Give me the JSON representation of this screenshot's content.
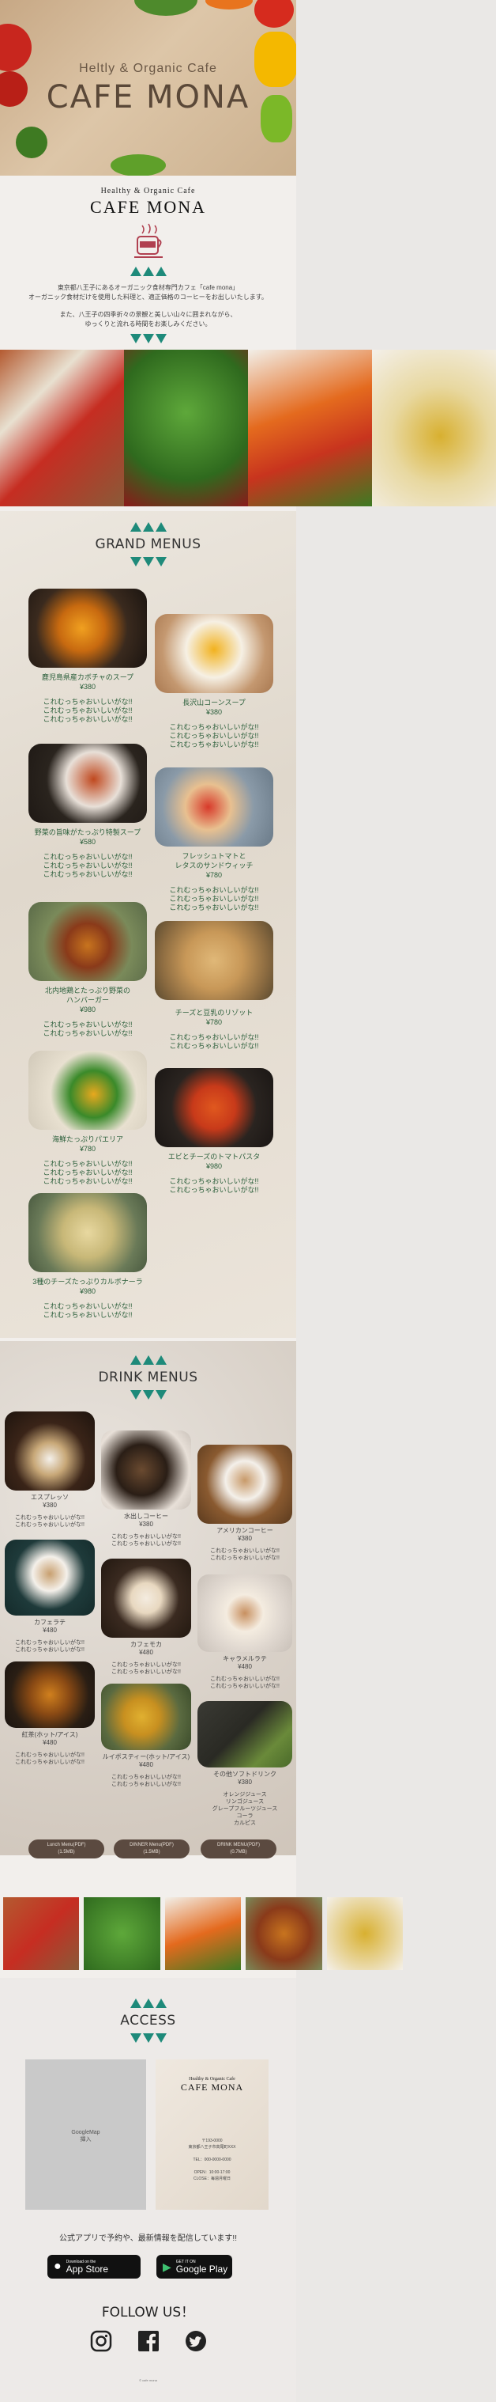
{
  "hero": {
    "subtitle": "Heltly & Organic Cafe",
    "title": "CAFE MONA"
  },
  "logo": {
    "subtitle": "Healthy & Organic Cafe",
    "title": "CAFE MONA"
  },
  "intro": {
    "line1": "東京都八王子にあるオーガニック食材専門カフェ「cafe mona」",
    "line2": "オーガニック食材だけを使用した料理と、適正価格のコーヒーをお出しいたします。",
    "line3": "また、八王子の四季折々の景観と美しい山々に囲まれながら、",
    "line4": "ゆっくりと流れる時間をお楽しみください。"
  },
  "grand": {
    "title": "GRAND MENUS",
    "items": [
      {
        "name": "鹿児島県産カボチャのスープ",
        "price": "¥380",
        "desc": "これむっちゃおいしいがな!!\nこれむっちゃおいしいがな!!\nこれむっちゃおいしいがな!!"
      },
      {
        "name": "長沢山コーンスープ",
        "price": "¥380",
        "desc": "これむっちゃおいしいがな!!\nこれむっちゃおいしいがな!!\nこれむっちゃおいしいがな!!"
      },
      {
        "name": "野菜の旨味がたっぷり特製スープ",
        "price": "¥580",
        "desc": "これむっちゃおいしいがな!!\nこれむっちゃおいしいがな!!\nこれむっちゃおいしいがな!!"
      },
      {
        "name": "フレッシュトマトと\nレタスのサンドウィッチ",
        "price": "¥780",
        "desc": "これむっちゃおいしいがな!!\nこれむっちゃおいしいがな!!\nこれむっちゃおいしいがな!!"
      },
      {
        "name": "北内地鶏とたっぷり野菜の\nハンバーガー",
        "price": "¥980",
        "desc": "これむっちゃおいしいがな!!\nこれむっちゃおいしいがな!!"
      },
      {
        "name": "チーズと豆乳のリゾット",
        "price": "¥780",
        "desc": "これむっちゃおいしいがな!!\nこれむっちゃおいしいがな!!"
      },
      {
        "name": "海鮮たっぷりパエリア",
        "price": "¥780",
        "desc": "これむっちゃおいしいがな!!\nこれむっちゃおいしいがな!!\nこれむっちゃおいしいがな!!"
      },
      {
        "name": "エビとチーズのトマトパスタ",
        "price": "¥980",
        "desc": "これむっちゃおいしいがな!!\nこれむっちゃおいしいがな!!"
      },
      {
        "name": "3種のチーズたっぷりカルボナーラ",
        "price": "¥980",
        "desc": "これむっちゃおいしいがな!!\nこれむっちゃおいしいがな!!"
      }
    ]
  },
  "drink": {
    "title": "DRINK MENUS",
    "items": [
      {
        "name": "エスプレッソ\n¥380",
        "desc": "これむっちゃおいしいがな!!\nこれむっちゃおいしいがな!!"
      },
      {
        "name": "水出しコーヒー\n¥380",
        "desc": "これむっちゃおいしいがな!!\nこれむっちゃおいしいがな!!"
      },
      {
        "name": "アメリカンコーヒー\n¥380",
        "desc": "これむっちゃおいしいがな!!\nこれむっちゃおいしいがな!!"
      },
      {
        "name": "カフェラテ\n¥480",
        "desc": "これむっちゃおいしいがな!!\nこれむっちゃおいしいがな!!"
      },
      {
        "name": "カフェモカ\n¥480",
        "desc": "これむっちゃおいしいがな!!\nこれむっちゃおいしいがな!!"
      },
      {
        "name": "キャラメルラテ\n¥480",
        "desc": "これむっちゃおいしいがな!!\nこれむっちゃおいしいがな!!"
      },
      {
        "name": "紅茶(ホット/アイス)\n¥480",
        "desc": "これむっちゃおいしいがな!!\nこれむっちゃおいしいがな!!"
      },
      {
        "name": "ルイボスティー(ホット/アイス)\n¥480",
        "desc": "これむっちゃおいしいがな!!\nこれむっちゃおいしいがな!!"
      },
      {
        "name": "その他ソフトドリンク\n¥380",
        "desc": "オレンジジュース\nリンゴジュース\nグレープフルーツジュース\nコーラ\nカルピス"
      }
    ],
    "pills": [
      {
        "l1": "Lunch Menu(PDF)",
        "l2": "(1.5MB)"
      },
      {
        "l1": "DINNER Menu(PDF)",
        "l2": "(1.5MB)"
      },
      {
        "l1": "DRINK MENU(PDF)",
        "l2": "(0.7MB)"
      }
    ]
  },
  "access": {
    "title": "ACCESS",
    "map_label": "GoogleMap\n挿入",
    "card_subtitle": "Healthy & Organic Cafe",
    "card_title": "CAFE MONA",
    "card_info": "〒193-0000\n東京都八王子市高尾町XXX\n\nTEL：000-0000-0000\n\nOPEN：10:00-17:00\nCLOSE：毎週月曜日"
  },
  "app": {
    "message": "公式アプリで予約や、最新情報を配信しています!!",
    "appstore_small": "Download on the",
    "appstore_big": "App Store",
    "googleplay_small": "GET IT ON",
    "googleplay_big": "Google Play"
  },
  "follow": {
    "title": "FOLLOW US！"
  },
  "footer": {
    "copyright": "© cafe mona"
  },
  "colors": {
    "accent": "#1e8a7a",
    "menu_text": "#2a5e3a",
    "pill": "#5b4a40"
  }
}
